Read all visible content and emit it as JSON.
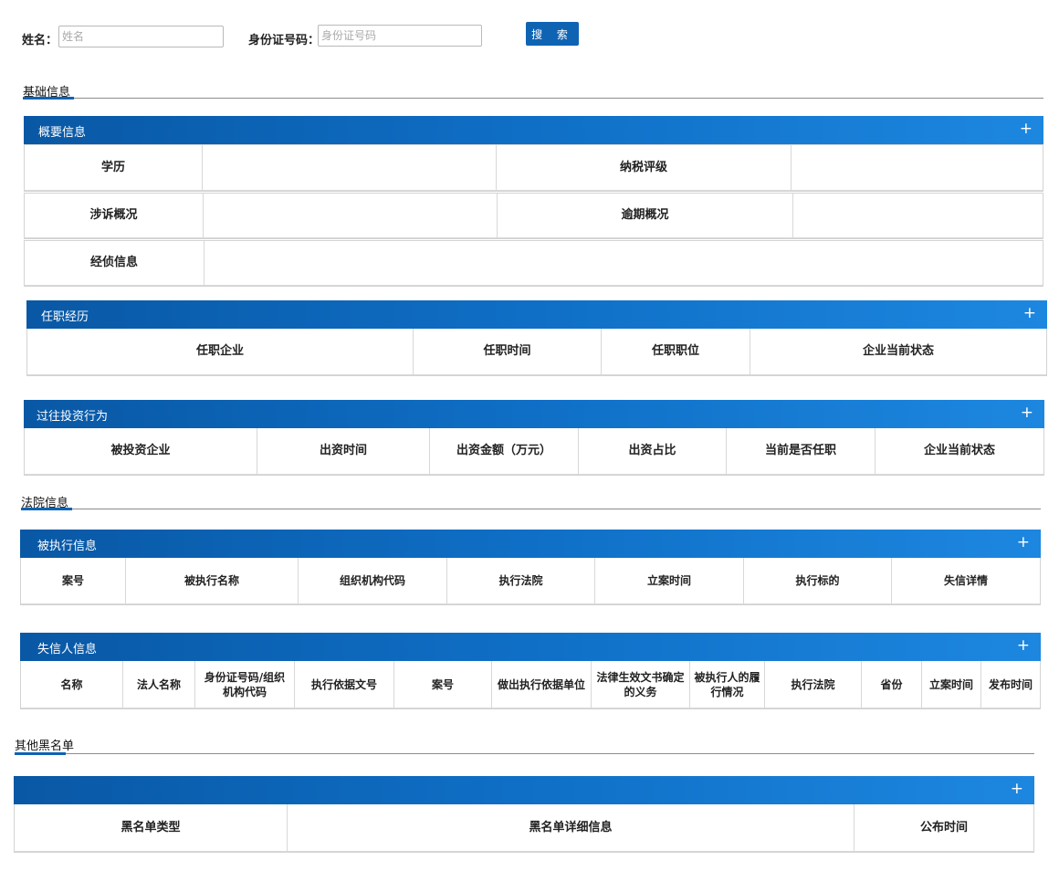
{
  "search": {
    "name_label": "姓名：",
    "name_placeholder": "姓名",
    "id_label": "身份证号码：",
    "id_placeholder": "身份证号码",
    "button_label": "搜 索"
  },
  "sections": {
    "basic": "基础信息",
    "court": "法院信息",
    "blacklist": "其他黑名单"
  },
  "overview": {
    "title": "概要信息",
    "plus": "+",
    "rows": [
      [
        "学历",
        "",
        "纳税评级",
        ""
      ],
      [
        "涉诉概况",
        "",
        "逾期概况",
        ""
      ],
      [
        "经侦信息",
        ""
      ]
    ]
  },
  "employment": {
    "title": "任职经历",
    "plus": "+",
    "headers": [
      "任职企业",
      "任职时间",
      "任职职位",
      "企业当前状态"
    ]
  },
  "investment": {
    "title": "过往投资行为",
    "plus": "+",
    "headers": [
      "被投资企业",
      "出资时间",
      "出资金额（万元）",
      "出资占比",
      "当前是否任职",
      "企业当前状态"
    ]
  },
  "executed": {
    "title": "被执行信息",
    "plus": "+",
    "headers": [
      "案号",
      "被执行名称",
      "组织机构代码",
      "执行法院",
      "立案时间",
      "执行标的",
      "失信详情"
    ]
  },
  "dishonest": {
    "title": "失信人信息",
    "plus": "+",
    "headers": [
      "名称",
      "法人名称",
      "身份证号码/组织机构代码",
      "执行依据文号",
      "案号",
      "做出执行依据单位",
      "法律生效文书确定的义务",
      "被执行人的履行情况",
      "执行法院",
      "省份",
      "立案时间",
      "发布时间"
    ]
  },
  "blacklist_panel": {
    "title": "",
    "plus": "+",
    "headers": [
      "黑名单类型",
      "黑名单详细信息",
      "公布时间"
    ]
  },
  "colors": {
    "accent": "#0f63b3",
    "bar_start": "#0958a5",
    "bar_end": "#1d87e0"
  }
}
